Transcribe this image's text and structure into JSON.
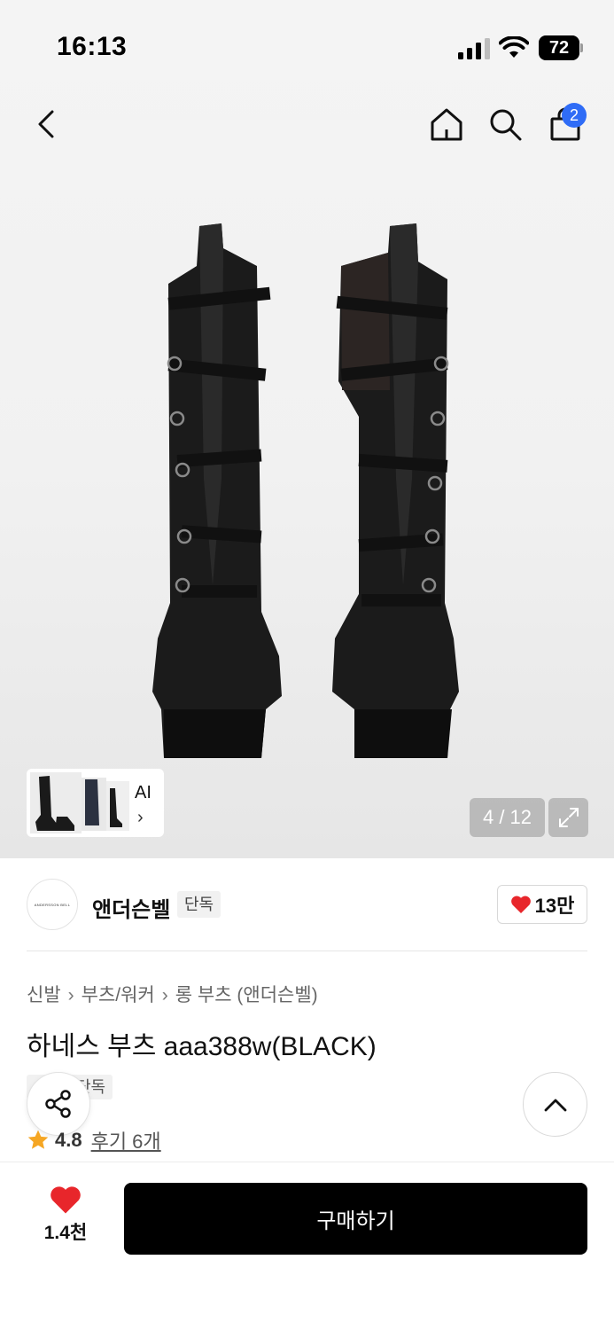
{
  "status_bar": {
    "time": "16:13",
    "battery": "72"
  },
  "header": {
    "cart_count": "2"
  },
  "gallery": {
    "ai_label": "AI",
    "ai_chevron": "›",
    "page_counter": "4 / 12"
  },
  "brand": {
    "logo_text": "ANDERSSON BELL",
    "name": "앤더슨벨",
    "tag": "단독",
    "like_count": "13만"
  },
  "breadcrumb": {
    "items": [
      "신발",
      "부츠/워커",
      "롱 부츠 (앤더슨벨)"
    ],
    "separator": "›"
  },
  "product": {
    "title": "하네스 부츠 aaa388w(BLACK)",
    "badge": "단독",
    "rating": "4.8",
    "review_link": "후기 6개"
  },
  "bottom_bar": {
    "wish_count": "1.4천",
    "buy_label": "구매하기"
  },
  "colors": {
    "accent_blue": "#2f6cf6",
    "heart_red": "#e8262b",
    "star_orange": "#f5a623"
  },
  "icons": [
    "back-icon",
    "home-icon",
    "search-icon",
    "bag-icon",
    "expand-icon",
    "heart-icon",
    "share-icon",
    "chevron-up-icon",
    "star-icon"
  ]
}
